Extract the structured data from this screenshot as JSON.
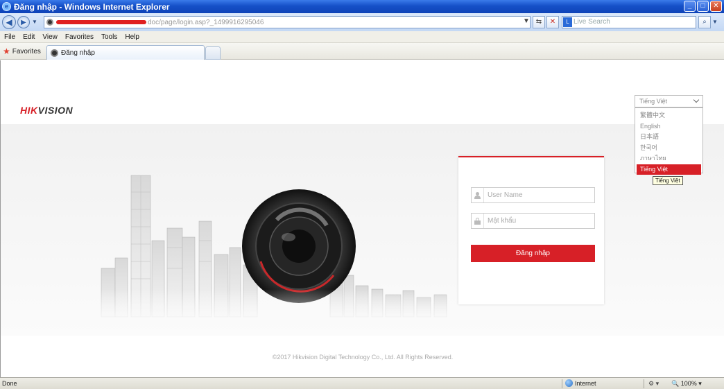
{
  "window": {
    "title": "Đăng nhập - Windows Internet Explorer",
    "controls": {
      "minimize": "_",
      "maximize": "□",
      "close": "✕"
    }
  },
  "addressbar": {
    "url_suffix": "doc/page/login.asp?_1499916295046",
    "search_placeholder": "Live Search"
  },
  "menu": {
    "items": [
      "File",
      "Edit",
      "View",
      "Favorites",
      "Tools",
      "Help"
    ]
  },
  "favorites": {
    "label": "Favorites",
    "tab_title": "Đăng nhập"
  },
  "page": {
    "logo_red": "HIK",
    "logo_rest": "VISION",
    "language": {
      "selected": "Tiếng Việt",
      "options": [
        "繁體中文",
        "English",
        "日本語",
        "한국어",
        "ภาษาไทย",
        "Tiếng Việt"
      ],
      "tooltip": "Tiếng Việt"
    },
    "login": {
      "username_placeholder": "User Name",
      "password_placeholder": "Mật khẩu",
      "submit_label": "Đăng nhập"
    },
    "footer": "©2017 Hikvision Digital Technology Co., Ltd. All Rights Reserved."
  },
  "statusbar": {
    "status": "Done",
    "zone": "Internet",
    "zoom": "100%"
  },
  "colors": {
    "brand_red": "#d72027",
    "titlebar_blue": "#1550c8"
  },
  "icons": [
    "ie-logo-icon",
    "back-icon",
    "forward-icon",
    "refresh-icon",
    "stop-icon",
    "search-icon",
    "star-icon",
    "user-icon",
    "lock-icon",
    "globe-icon"
  ]
}
